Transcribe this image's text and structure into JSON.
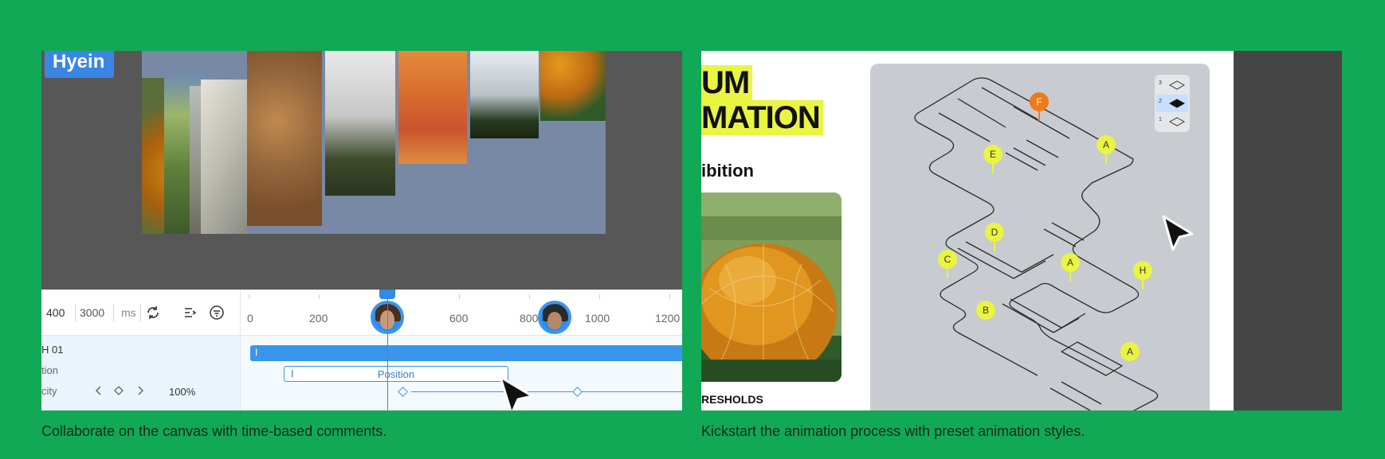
{
  "left_panel": {
    "collaborator_name": "Hyein",
    "timeline": {
      "controls": {
        "start_value": "400",
        "duration_value": "3000",
        "unit": "ms",
        "zoom": "100%"
      },
      "ruler_labels": [
        "0",
        "200",
        "600",
        "800",
        "1000",
        "1200"
      ],
      "playhead_ms": 400,
      "tracks": {
        "group_label": "H 01",
        "position_label": "tion",
        "opacity_label": "city",
        "bar_marker": "I",
        "position_bar_label": "Position",
        "position_bar_marker": "I"
      }
    },
    "icons": [
      "loop-icon",
      "list-indent-icon",
      "filter-icon",
      "chevron-left-icon",
      "diamond-icon",
      "chevron-right-icon",
      "pause-icon"
    ]
  },
  "right_panel": {
    "headline_line1": "UM",
    "headline_line2": "MATION",
    "subtitle": "ibition",
    "section_label": "RESHOLDS",
    "floor_selector": [
      "3",
      "2",
      "1"
    ],
    "selected_floor": "2",
    "map_pins": [
      "F",
      "E",
      "A",
      "D",
      "C",
      "A",
      "H",
      "B",
      "A"
    ],
    "accent_color": "#e9f542",
    "active_pin_color": "#f07a1a"
  },
  "captions": {
    "left": "Collaborate on the canvas with time-based comments.",
    "right": "Kickstart the animation process with preset animation styles."
  },
  "colors": {
    "background": "#11a955",
    "timeline_accent": "#3a95ec"
  }
}
